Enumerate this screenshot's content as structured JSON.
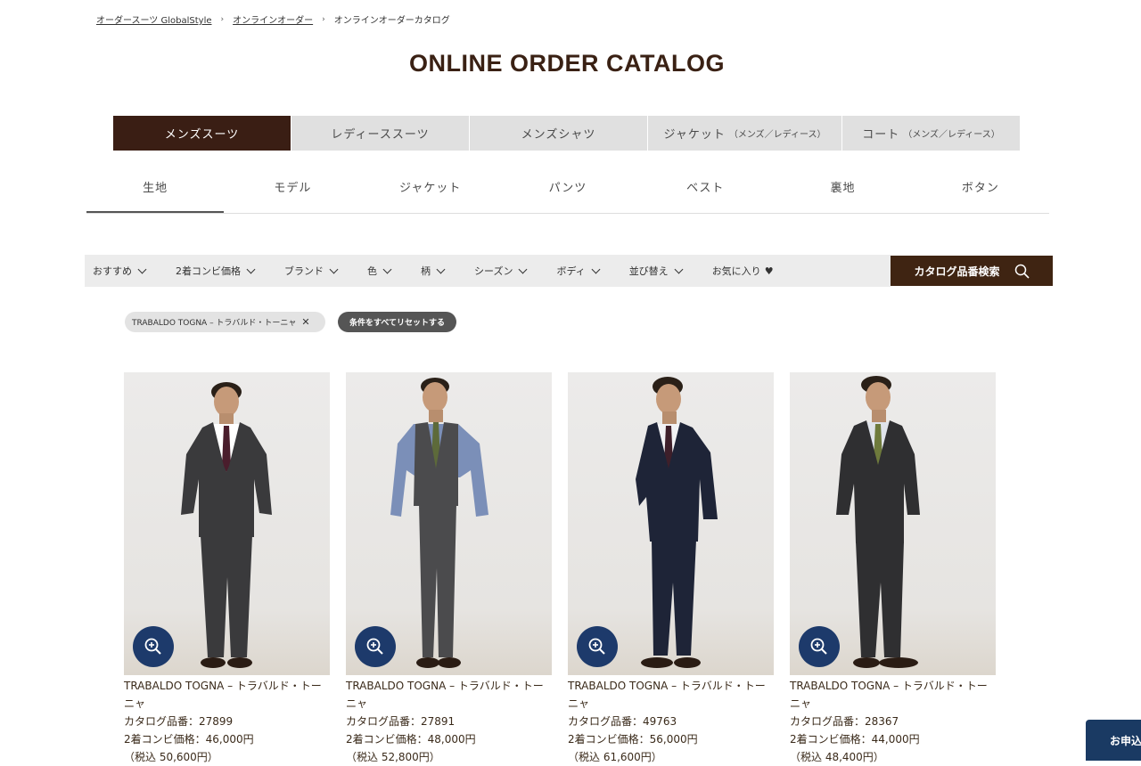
{
  "breadcrumb": {
    "home": "オーダースーツ GlobalStyle",
    "online_order": "オンラインオーダー",
    "current": "オンラインオーダーカタログ"
  },
  "page_title": "ONLINE ORDER CATALOG",
  "category_tabs": [
    {
      "label": "メンズスーツ",
      "sub": ""
    },
    {
      "label": "レディーススーツ",
      "sub": ""
    },
    {
      "label": "メンズシャツ",
      "sub": ""
    },
    {
      "label": "ジャケット",
      "sub": "（メンズ／レディース）"
    },
    {
      "label": "コート",
      "sub": "（メンズ／レディース）"
    }
  ],
  "sub_tabs": [
    "生地",
    "モデル",
    "ジャケット",
    "パンツ",
    "ベスト",
    "裏地",
    "ボタン"
  ],
  "filters": [
    "おすすめ",
    "2着コンビ価格",
    "ブランド",
    "色",
    "柄",
    "シーズン",
    "ボディ",
    "並び替え"
  ],
  "favorites_label": "お気に入り",
  "search_button": "カタログ品番検索",
  "active_filter_chip": "TRABALDO TOGNA – トラバルド・トーニャ",
  "reset_button": "条件をすべてリセットする",
  "products": [
    {
      "name": "TRABALDO TOGNA – トラバルド・トーニャ",
      "catalog_no": "カタログ品番：27899",
      "price": "2着コンビ価格：46,000円",
      "tax_price": "（税込 50,600円）",
      "suit_color": "#3a3a3c",
      "shirt": "#ffffff",
      "tie": "#4a1d2c"
    },
    {
      "name": "TRABALDO TOGNA – トラバルド・トーニャ",
      "catalog_no": "カタログ品番：27891",
      "price": "2着コンビ価格：48,000円",
      "tax_price": "（税込 52,800円）",
      "suit_color": "#4b4b4d",
      "shirt": "#7b8fb8",
      "tie": "#5d6a3a"
    },
    {
      "name": "TRABALDO TOGNA – トラバルド・トーニャ",
      "catalog_no": "カタログ品番：49763",
      "price": "2着コンビ価格：56,000円",
      "tax_price": "（税込 61,600円）",
      "suit_color": "#1e2437",
      "shirt": "#f2f2f4",
      "tie": "#3e1f2a"
    },
    {
      "name": "TRABALDO TOGNA – トラバルド・トーニャ",
      "catalog_no": "カタログ品番：28367",
      "price": "2着コンビ価格：44,000円",
      "tax_price": "（税込 48,400円）",
      "suit_color": "#2f2f31",
      "shirt": "#dfe3ea",
      "tie": "#6e7a3c"
    }
  ],
  "apply_button": "お申込"
}
